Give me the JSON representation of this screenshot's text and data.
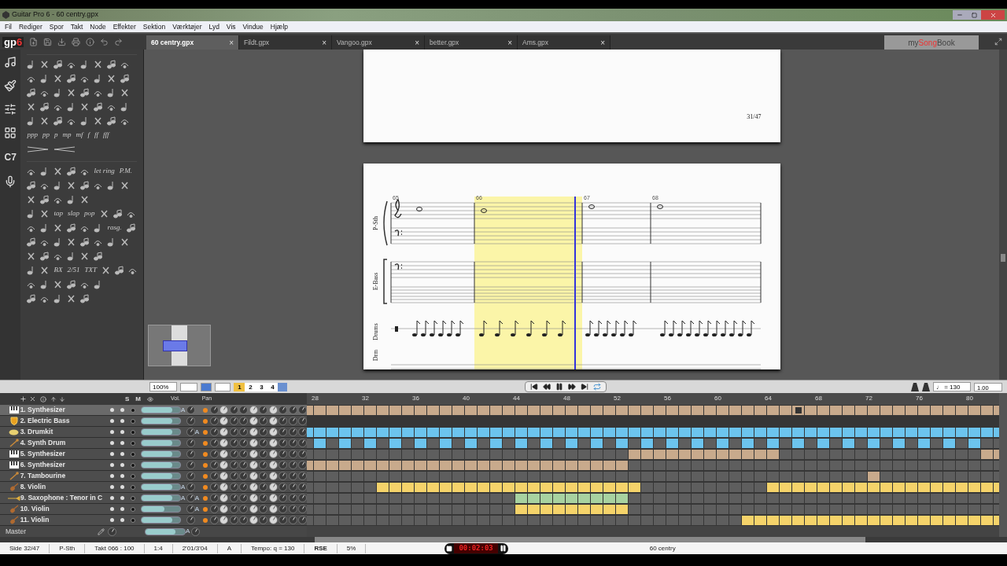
{
  "window": {
    "title": "Guitar Pro 6 - 60 centry.gpx"
  },
  "menu": [
    "Fil",
    "Rediger",
    "Spor",
    "Takt",
    "Node",
    "Effekter",
    "Sektion",
    "Værktøjer",
    "Lyd",
    "Vis",
    "Vindue",
    "Hjælp"
  ],
  "logo": {
    "text": "gp",
    "accent": "6"
  },
  "tabs": [
    {
      "label": "60 centry.gpx",
      "selected": true,
      "close": "×"
    },
    {
      "label": "Fildt.gpx",
      "selected": false,
      "close": "×"
    },
    {
      "label": "Vangoo.gpx",
      "selected": false,
      "close": "×"
    },
    {
      "label": "better.gpx",
      "selected": false,
      "close": "×"
    },
    {
      "label": "Ams.gpx",
      "selected": false,
      "close": "×"
    }
  ],
  "songbook": {
    "parts": [
      "my",
      "Song",
      "Book"
    ]
  },
  "sidebar": {
    "chord_label": "C7"
  },
  "palette": [
    [
      [
        {
          "kind": "icon"
        },
        {
          "kind": "icon"
        },
        {
          "kind": "icon"
        },
        {
          "kind": "icon"
        },
        {
          "kind": "icon"
        },
        {
          "kind": "icon"
        },
        {
          "kind": "icon"
        },
        {
          "kind": "icon"
        }
      ],
      [
        {
          "kind": "icon"
        },
        {
          "kind": "icon"
        },
        {
          "kind": "icon"
        },
        {
          "kind": "icon"
        },
        {
          "kind": "icon"
        },
        {
          "kind": "icon"
        },
        {
          "kind": "icon"
        },
        {
          "kind": "icon"
        }
      ],
      [
        {
          "kind": "icon"
        },
        {
          "kind": "icon"
        },
        {
          "kind": "icon"
        },
        {
          "kind": "icon"
        },
        {
          "kind": "icon"
        },
        {
          "kind": "icon"
        },
        {
          "kind": "icon"
        },
        {
          "kind": "icon"
        }
      ],
      [
        {
          "kind": "icon"
        },
        {
          "kind": "icon"
        },
        {
          "kind": "icon"
        },
        {
          "kind": "icon"
        },
        {
          "kind": "icon"
        },
        {
          "kind": "icon"
        },
        {
          "kind": "icon"
        },
        {
          "kind": "icon"
        }
      ],
      [
        {
          "kind": "icon"
        },
        {
          "kind": "icon"
        },
        {
          "kind": "icon"
        },
        {
          "kind": "icon"
        },
        {
          "kind": "icon"
        },
        {
          "kind": "icon"
        },
        {
          "kind": "icon"
        },
        {
          "kind": "icon"
        }
      ],
      [
        {
          "kind": "text",
          "text": "ppp"
        },
        {
          "kind": "text",
          "text": "pp"
        },
        {
          "kind": "text",
          "text": "p"
        },
        {
          "kind": "text",
          "text": "mp"
        },
        {
          "kind": "text",
          "text": "mf"
        },
        {
          "kind": "text",
          "text": "f"
        },
        {
          "kind": "text",
          "text": "ff"
        },
        {
          "kind": "text",
          "text": "fff"
        }
      ],
      [
        {
          "kind": "hairpin"
        },
        {
          "kind": "hairpin"
        }
      ]
    ],
    [
      [
        {
          "kind": "icon"
        },
        {
          "kind": "icon"
        },
        {
          "kind": "icon"
        },
        {
          "kind": "icon"
        },
        {
          "kind": "icon"
        },
        {
          "kind": "text",
          "text": "let ring"
        },
        {
          "kind": "text",
          "text": "P.M."
        }
      ],
      [
        {
          "kind": "icon"
        },
        {
          "kind": "icon"
        },
        {
          "kind": "icon"
        },
        {
          "kind": "icon"
        },
        {
          "kind": "icon"
        },
        {
          "kind": "icon"
        },
        {
          "kind": "icon"
        },
        {
          "kind": "icon"
        }
      ],
      [
        {
          "kind": "icon"
        },
        {
          "kind": "icon"
        },
        {
          "kind": "icon"
        },
        {
          "kind": "icon"
        },
        {
          "kind": "icon"
        }
      ],
      [
        {
          "kind": "icon"
        },
        {
          "kind": "icon"
        },
        {
          "kind": "text",
          "text": "tap"
        },
        {
          "kind": "text",
          "text": "slap"
        },
        {
          "kind": "text",
          "text": "pop"
        },
        {
          "kind": "icon"
        },
        {
          "kind": "icon"
        },
        {
          "kind": "icon"
        }
      ],
      [
        {
          "kind": "icon"
        },
        {
          "kind": "icon"
        },
        {
          "kind": "icon"
        },
        {
          "kind": "icon"
        },
        {
          "kind": "icon"
        },
        {
          "kind": "icon"
        },
        {
          "kind": "text",
          "text": "rasg."
        },
        {
          "kind": "icon"
        }
      ],
      [
        {
          "kind": "icon"
        },
        {
          "kind": "icon"
        },
        {
          "kind": "icon"
        },
        {
          "kind": "icon"
        },
        {
          "kind": "icon"
        },
        {
          "kind": "icon"
        },
        {
          "kind": "icon"
        },
        {
          "kind": "icon"
        }
      ],
      [
        {
          "kind": "icon"
        },
        {
          "kind": "icon"
        },
        {
          "kind": "icon"
        },
        {
          "kind": "icon"
        },
        {
          "kind": "icon"
        },
        {
          "kind": "icon"
        }
      ],
      [
        {
          "kind": "icon"
        },
        {
          "kind": "icon"
        },
        {
          "kind": "text",
          "text": "BX"
        },
        {
          "kind": "text",
          "text": "2/51"
        },
        {
          "kind": "text",
          "text": "TXT"
        },
        {
          "kind": "icon"
        },
        {
          "kind": "icon"
        },
        {
          "kind": "icon"
        }
      ],
      [
        {
          "kind": "icon"
        },
        {
          "kind": "icon"
        },
        {
          "kind": "icon"
        },
        {
          "kind": "icon"
        },
        {
          "kind": "icon"
        },
        {
          "kind": "icon"
        }
      ],
      [
        {
          "kind": "icon"
        },
        {
          "kind": "icon"
        },
        {
          "kind": "icon"
        },
        {
          "kind": "icon"
        },
        {
          "kind": "icon"
        }
      ]
    ]
  ],
  "score": {
    "page_number": "31/47",
    "measures": [
      "65",
      "66",
      "67",
      "68"
    ],
    "staff_labels": [
      "P-Sth",
      "E-Bass",
      "Drums",
      "Drm"
    ]
  },
  "toolbar": {
    "zoom": "100%",
    "voices": [
      {
        "label": "1",
        "selected": true
      },
      {
        "label": "2",
        "selected": false
      },
      {
        "label": "3",
        "selected": false
      },
      {
        "label": "4",
        "selected": false
      }
    ],
    "tempo": "♩ = 130",
    "speed": "1.00"
  },
  "track_header": {
    "solo": "S",
    "mute": "M",
    "volume": "Vol.",
    "pan": "Pan"
  },
  "ruler": [
    "28",
    "32",
    "36",
    "40",
    "44",
    "48",
    "52",
    "56",
    "60",
    "64",
    "68",
    "72",
    "76",
    "80"
  ],
  "tracks": [
    {
      "name": "1. Synthesizer",
      "kind": "keyboard",
      "selected": true,
      "level": 0.8,
      "vol_auto": "A",
      "color": "#c8aa8c",
      "cells": [
        true,
        true,
        true,
        true,
        true,
        true,
        true,
        true,
        true,
        true,
        true,
        true,
        true,
        true,
        true,
        true,
        true,
        true,
        true,
        true,
        true,
        true,
        true,
        true,
        true,
        true,
        true,
        true,
        true,
        true,
        true,
        true,
        true,
        true,
        true,
        true,
        true,
        true,
        true,
        true,
        true,
        true,
        true,
        true,
        true,
        true,
        true,
        true,
        true,
        true,
        true,
        true,
        true,
        true,
        true,
        true
      ],
      "marked": [
        false,
        false,
        false,
        false,
        false,
        false,
        false,
        false,
        false,
        false,
        false,
        false,
        false,
        false,
        false,
        false,
        false,
        false,
        false,
        false,
        false,
        false,
        false,
        false,
        false,
        false,
        false,
        false,
        false,
        false,
        false,
        false,
        false,
        false,
        false,
        false,
        false,
        false,
        false,
        true,
        false,
        false,
        false,
        false,
        false,
        false,
        false,
        false,
        false,
        false,
        false,
        false,
        false,
        false,
        false,
        false
      ]
    },
    {
      "name": "2. Electric Bass",
      "kind": "bass",
      "selected": false,
      "level": 0.8
    },
    {
      "name": "3. Drumkit",
      "kind": "cymbal",
      "selected": false,
      "level": 0.8,
      "pan_auto": "A",
      "color": "#6cc4ee",
      "cells": [
        true,
        true,
        true,
        true,
        true,
        true,
        true,
        true,
        true,
        true,
        true,
        true,
        true,
        true,
        true,
        true,
        true,
        true,
        true,
        true,
        true,
        true,
        true,
        true,
        true,
        true,
        true,
        true,
        true,
        true,
        true,
        true,
        true,
        true,
        true,
        true,
        true,
        true,
        true,
        true,
        true,
        true,
        true,
        true,
        true,
        true,
        true,
        true,
        true,
        true,
        true,
        true,
        true,
        true,
        true,
        true
      ]
    },
    {
      "name": "4. Synth Drum",
      "kind": "drumstick",
      "selected": false,
      "level": 0.8,
      "color": "#6cc4ee",
      "cells": [
        false,
        true,
        false,
        true,
        false,
        true,
        false,
        true,
        false,
        true,
        false,
        true,
        false,
        true,
        false,
        true,
        false,
        true,
        false,
        true,
        false,
        true,
        false,
        true,
        false,
        true,
        false,
        true,
        false,
        true,
        false,
        true,
        false,
        true,
        false,
        true,
        false,
        true,
        false,
        true,
        false,
        true,
        false,
        true,
        false,
        true,
        false,
        true,
        false,
        true,
        false,
        true,
        false,
        true,
        false,
        false
      ]
    },
    {
      "name": "5. Synthesizer",
      "kind": "keyboard",
      "selected": false,
      "level": 0.8,
      "color": "#c8aa8c",
      "cells": [
        false,
        false,
        false,
        false,
        false,
        false,
        false,
        false,
        false,
        false,
        false,
        false,
        false,
        false,
        false,
        false,
        false,
        false,
        false,
        false,
        false,
        false,
        false,
        false,
        false,
        false,
        true,
        true,
        true,
        true,
        true,
        true,
        true,
        true,
        true,
        true,
        true,
        true,
        false,
        false,
        false,
        false,
        false,
        false,
        false,
        false,
        false,
        false,
        false,
        false,
        false,
        false,
        false,
        false,
        true,
        true
      ]
    },
    {
      "name": "6. Synthesizer",
      "kind": "keyboard",
      "selected": false,
      "level": 0.8,
      "color": "#c8aa8c",
      "cells": [
        true,
        true,
        true,
        true,
        true,
        true,
        true,
        true,
        true,
        true,
        true,
        true,
        true,
        true,
        true,
        true,
        true,
        true,
        true,
        true,
        true,
        true,
        true,
        true,
        true,
        true,
        false,
        false,
        false,
        false,
        false,
        false,
        false,
        false,
        false,
        false,
        false,
        false,
        false,
        false,
        false,
        false,
        false,
        false,
        false,
        false,
        false,
        false,
        false,
        false,
        false,
        false,
        false,
        false,
        false,
        false
      ]
    },
    {
      "name": "7. Tambourine",
      "kind": "drumstick",
      "selected": false,
      "level": 0.8,
      "color": "#c8aa8c",
      "cells": [
        false,
        false,
        false,
        false,
        false,
        false,
        false,
        false,
        false,
        false,
        false,
        false,
        false,
        false,
        false,
        false,
        false,
        false,
        false,
        false,
        false,
        false,
        false,
        false,
        false,
        false,
        false,
        false,
        false,
        false,
        false,
        false,
        false,
        false,
        false,
        false,
        false,
        false,
        false,
        false,
        false,
        false,
        false,
        false,
        false,
        true,
        false,
        false,
        false,
        false,
        false,
        false,
        false,
        false,
        false,
        false
      ]
    },
    {
      "name": "8. Violin",
      "kind": "violin",
      "selected": false,
      "level": 0.8,
      "vol_auto": "A",
      "color": "#f5d36a",
      "cells": [
        false,
        false,
        false,
        false,
        false,
        false,
        true,
        true,
        true,
        true,
        true,
        true,
        true,
        true,
        true,
        true,
        true,
        true,
        true,
        true,
        true,
        true,
        true,
        true,
        true,
        true,
        true,
        false,
        false,
        false,
        false,
        false,
        false,
        false,
        false,
        false,
        false,
        true,
        true,
        true,
        true,
        true,
        true,
        true,
        true,
        true,
        true,
        true,
        true,
        true,
        true,
        true,
        true,
        true,
        true,
        true
      ]
    },
    {
      "name": "9. Saxophone : Tenor in C",
      "kind": "horn",
      "selected": false,
      "level": 0.8,
      "vol_auto": "A",
      "pan_auto": "A",
      "color": "#a8d2a0",
      "cells": [
        false,
        false,
        false,
        false,
        false,
        false,
        false,
        false,
        false,
        false,
        false,
        false,
        false,
        false,
        false,
        false,
        false,
        true,
        true,
        true,
        true,
        true,
        true,
        true,
        true,
        true,
        false,
        false,
        false,
        false,
        false,
        false,
        false,
        false,
        false,
        false,
        false,
        false,
        false,
        false,
        false,
        false,
        false,
        false,
        false,
        false,
        false,
        false,
        false,
        false,
        false,
        false,
        false,
        false,
        false,
        false
      ]
    },
    {
      "name": "10. Violin",
      "kind": "violin",
      "selected": false,
      "level": 0.6,
      "pan_auto": "A",
      "color": "#f5d36a",
      "cells": [
        false,
        false,
        false,
        false,
        false,
        false,
        false,
        false,
        false,
        false,
        false,
        false,
        false,
        false,
        false,
        false,
        false,
        true,
        true,
        true,
        true,
        true,
        true,
        true,
        true,
        true,
        false,
        false,
        false,
        false,
        false,
        false,
        false,
        false,
        false,
        false,
        false,
        false,
        false,
        false,
        false,
        false,
        false,
        false,
        false,
        false,
        false,
        false,
        false,
        false,
        false,
        false,
        false,
        false,
        false,
        false
      ]
    },
    {
      "name": "11. Violin",
      "kind": "violin",
      "selected": false,
      "level": 0.8,
      "color": "#f5d36a",
      "cells": [
        false,
        false,
        false,
        false,
        false,
        false,
        false,
        false,
        false,
        false,
        false,
        false,
        false,
        false,
        false,
        false,
        false,
        false,
        false,
        false,
        false,
        false,
        false,
        false,
        false,
        false,
        false,
        false,
        false,
        false,
        false,
        false,
        false,
        false,
        false,
        true,
        true,
        true,
        true,
        true,
        true,
        true,
        true,
        true,
        true,
        true,
        true,
        true,
        true,
        true,
        true,
        true,
        true,
        true,
        true,
        true
      ]
    }
  ],
  "master": {
    "name": "Master",
    "level": 0.75,
    "vol_auto": "A"
  },
  "transport": {
    "time": "00:02:03"
  },
  "status_bar": [
    "Side 32/47",
    "P-Sth",
    "Takt 066 : 100",
    "1:4",
    "2'01/3'04",
    "A",
    "Tempo: q = 130",
    "RSE",
    "5%"
  ],
  "status_song": "60 centry"
}
